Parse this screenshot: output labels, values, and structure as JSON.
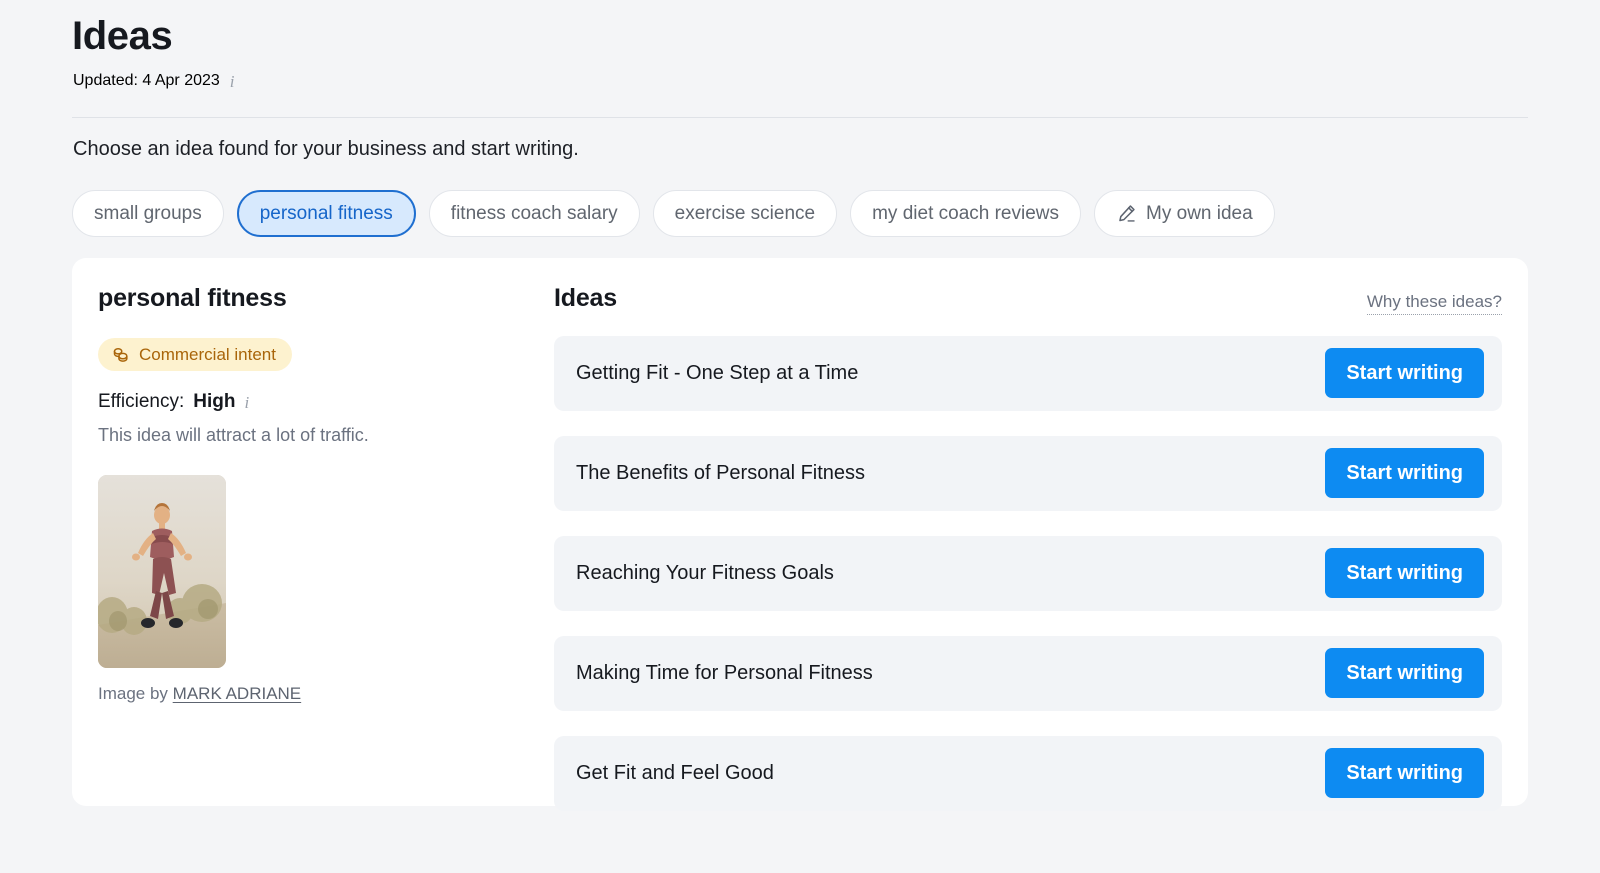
{
  "header": {
    "title": "Ideas",
    "updated": "Updated: 4 Apr 2023",
    "info_icon": "info-icon",
    "subtitle": "Choose an idea found for your business and start writing."
  },
  "chips": [
    {
      "label": "small groups",
      "selected": false,
      "icon": null
    },
    {
      "label": "personal fitness",
      "selected": true,
      "icon": null
    },
    {
      "label": "fitness coach salary",
      "selected": false,
      "icon": null
    },
    {
      "label": "exercise science",
      "selected": false,
      "icon": null
    },
    {
      "label": "my diet coach reviews",
      "selected": false,
      "icon": null
    },
    {
      "label": "My own idea",
      "selected": false,
      "icon": "pencil-icon"
    }
  ],
  "detail": {
    "keyword": "personal fitness",
    "intent_badge": {
      "label": "Commercial intent",
      "icon": "coins-icon",
      "bg": "#fdf2cf",
      "color": "#a9650a"
    },
    "efficiency_label": "Efficiency:",
    "efficiency_value": "High",
    "efficiency_info_icon": "info-icon",
    "efficiency_description": "This idea will attract a lot of traffic.",
    "image_credit_prefix": "Image by",
    "image_credit_author": "MARK ADRIANE"
  },
  "ideas_panel": {
    "title": "Ideas",
    "why_link": "Why these ideas?",
    "button_label": "Start writing",
    "button_color": "#0d8bf2",
    "items": [
      {
        "title": "Getting Fit - One Step at a Time"
      },
      {
        "title": "The Benefits of Personal Fitness"
      },
      {
        "title": "Reaching Your Fitness Goals"
      },
      {
        "title": "Making Time for Personal Fitness"
      },
      {
        "title": "Get Fit and Feel Good"
      }
    ]
  }
}
